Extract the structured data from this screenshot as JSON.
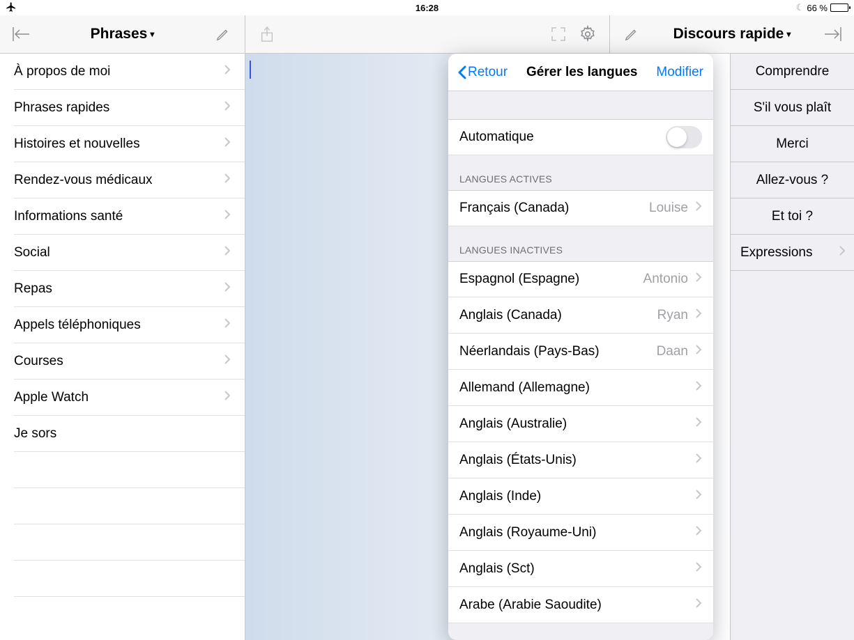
{
  "statusbar": {
    "time": "16:28",
    "battery_pct": "66 %"
  },
  "toolbar": {
    "left_title": "Phrases",
    "right_title": "Discours rapide"
  },
  "left_list": {
    "items": [
      "À propos de moi",
      "Phrases rapides",
      "Histoires et nouvelles",
      "Rendez-vous médicaux",
      "Informations santé",
      "Social",
      "Repas",
      "Appels téléphoniques",
      "Courses",
      "Apple Watch",
      "Je sors"
    ]
  },
  "quick_list": {
    "items": [
      "Comprendre",
      "S'il vous plaît",
      "Merci",
      "Allez-vous ?",
      "Et toi ?"
    ],
    "expressions": "Expressions"
  },
  "popover": {
    "back": "Retour",
    "title": "Gérer les langues",
    "edit": "Modifier",
    "auto_label": "Automatique",
    "section_active": "LANGUES ACTIVES",
    "section_inactive": "LANGUES INACTIVES",
    "active": [
      {
        "lang": "Français (Canada)",
        "voice": "Louise"
      }
    ],
    "inactive": [
      {
        "lang": "Espagnol (Espagne)",
        "voice": "Antonio"
      },
      {
        "lang": "Anglais (Canada)",
        "voice": "Ryan"
      },
      {
        "lang": "Néerlandais (Pays-Bas)",
        "voice": "Daan"
      },
      {
        "lang": "Allemand (Allemagne)",
        "voice": ""
      },
      {
        "lang": "Anglais (Australie)",
        "voice": ""
      },
      {
        "lang": "Anglais (États-Unis)",
        "voice": ""
      },
      {
        "lang": "Anglais (Inde)",
        "voice": ""
      },
      {
        "lang": "Anglais (Royaume-Uni)",
        "voice": ""
      },
      {
        "lang": "Anglais (Sct)",
        "voice": ""
      },
      {
        "lang": "Arabe (Arabie Saoudite)",
        "voice": ""
      }
    ]
  }
}
